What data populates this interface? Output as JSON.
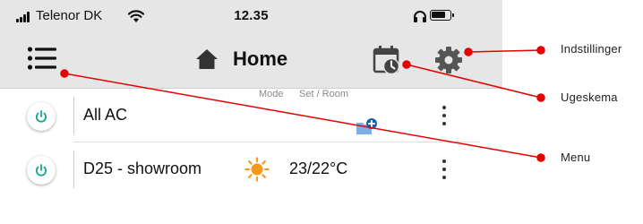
{
  "status_bar": {
    "carrier": "Telenor DK",
    "time": "12.35",
    "icons": [
      "signal-bars-icon",
      "wifi-icon",
      "headphones-icon",
      "battery-icon"
    ]
  },
  "nav": {
    "title": "Home",
    "icons": [
      "menu-icon",
      "home-icon",
      "calendar-clock-icon",
      "gear-icon"
    ]
  },
  "list": {
    "column_labels": {
      "mode": "Mode",
      "set_room": "Set / Room"
    },
    "rows": [
      {
        "name": "All AC",
        "icons": [
          "power-icon",
          "folder-add-icon",
          "kebab-menu-icon"
        ]
      },
      {
        "name": "D25 - showroom",
        "temperature": "23/22°C",
        "icons": [
          "power-icon",
          "sun-icon",
          "kebab-menu-icon"
        ]
      }
    ]
  },
  "callouts": {
    "settings": "Indstillinger",
    "schedule": "Ugeskema",
    "menu": "Menu"
  },
  "colors": {
    "bar_background": "#e6e6e6",
    "power_teal": "#1aa58c",
    "heat_orange": "#f39a1e",
    "callout_red": "#e60000",
    "folder_blue": "#4f8fd6"
  }
}
